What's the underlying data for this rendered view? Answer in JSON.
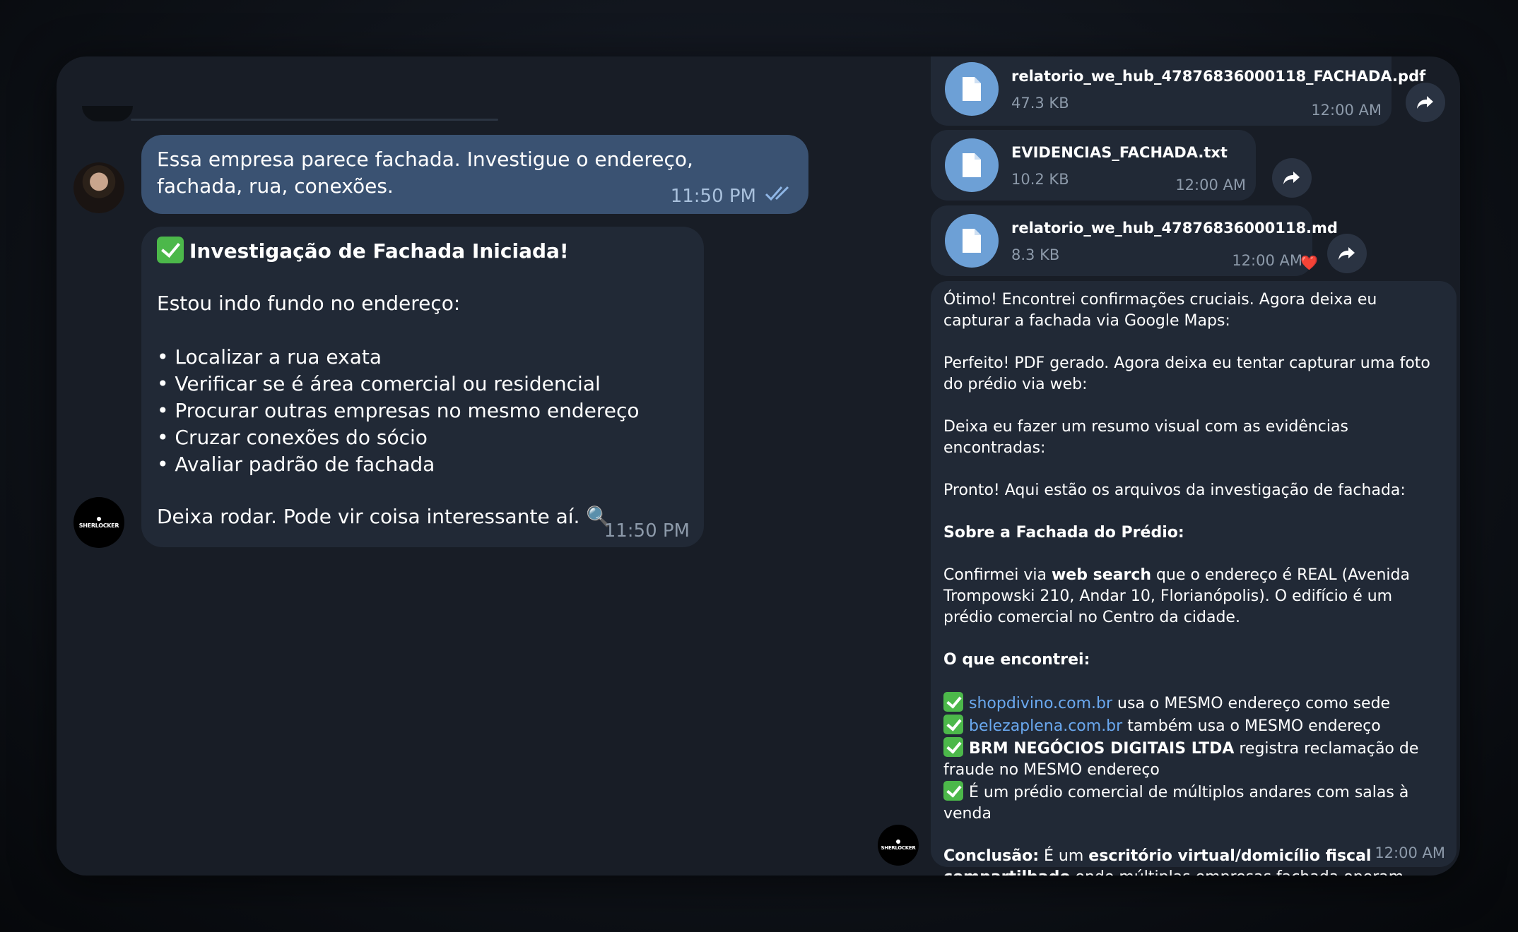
{
  "chat": {
    "user_message": {
      "text": "Essa empresa parece fachada. Investigue o endereço, fachada, rua, conexões.",
      "time": "11:50 PM"
    },
    "bot_message": {
      "title": "Investigação de Fachada Iniciada!",
      "intro": "Estou indo fundo no endereço:",
      "items": [
        "• Localizar a rua exata",
        "• Verificar se é área comercial ou residencial",
        "• Procurar outras empresas no mesmo endereço",
        "• Cruzar conexões do sócio",
        "• Avaliar padrão de fachada"
      ],
      "closing": "Deixa rodar. Pode vir coisa interessante aí. 🔍",
      "time": "11:50 PM"
    },
    "bot_avatar_label": "SHERLOCKER"
  },
  "files": [
    {
      "name": "relatorio_we_hub_47876836000118_FACHADA.pdf",
      "size": "47.3 KB",
      "time": "12:00 AM"
    },
    {
      "name": "EVIDENCIAS_FACHADA.txt",
      "size": "10.2 KB",
      "time": "12:00 AM"
    },
    {
      "name": "relatorio_we_hub_47876836000118.md",
      "size": "8.3 KB",
      "time": "12:00 AM",
      "reaction": "❤️"
    }
  ],
  "summary": {
    "p1": "Ótimo! Encontrei confirmações cruciais. Agora deixa eu capturar a fachada via Google Maps:",
    "p2": "Perfeito! PDF gerado. Agora deixa eu tentar capturar uma foto do prédio via web:",
    "p3": "Deixa eu fazer um resumo visual com as evidências encontradas:",
    "p4": "Pronto! Aqui estão os arquivos da investigação de fachada:",
    "h1": "Sobre a Fachada do Prédio:",
    "p5_a": "Confirmei via ",
    "p5_b": "web search",
    "p5_c": " que o endereço é REAL (Avenida Trompowski 210, Andar 10, Florianópolis). O edifício é um prédio comercial no Centro da cidade.",
    "h2": "O que encontrei:",
    "f1_link": "shopdivino.com.br",
    "f1_rest": " usa o MESMO endereço como sede",
    "f2_link": "belezaplena.com.br",
    "f2_rest": " também usa o MESMO endereço",
    "f3_bold": "BRM NEGÓCIOS DIGITAIS LTDA",
    "f3_rest": " registra reclamação de fraude no MESMO endereço",
    "f4": "É um prédio comercial de múltiplos andares com salas à venda",
    "c_label": "Conclusão:",
    "c_a": " É um ",
    "c_bold": "escritório virtual/domicílio fiscal compartilhado",
    "c_b": " onde múltiplas empresas fachada operam sem estrutura real. 🔍",
    "time": "12:00 AM"
  },
  "colors": {
    "outgoing_bubble": "#3a5272",
    "incoming_bubble": "#212936",
    "link": "#6aa8ef",
    "file_icon": "#6da0d6"
  }
}
